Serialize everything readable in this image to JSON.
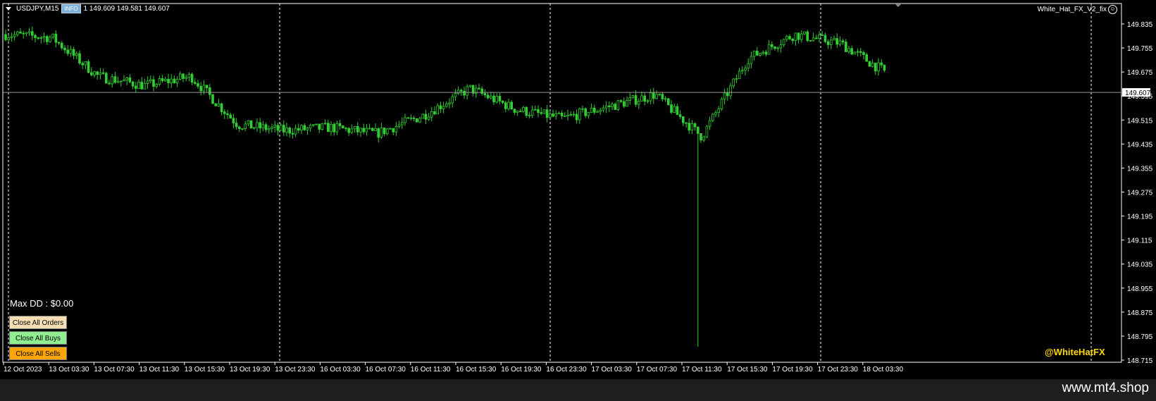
{
  "header": {
    "symbol": "USDJPY,M15",
    "info_badge": "INFO",
    "ohlc_text": "1 149.609 149.581 149.607"
  },
  "ea_name": "White_Hat_FX_V2_fix",
  "price_axis": {
    "labels": [
      "149.835",
      "149.755",
      "149.675",
      "149.595",
      "149.515",
      "149.435",
      "149.355",
      "149.275",
      "149.195",
      "149.115",
      "149.035",
      "148.955",
      "148.875",
      "148.795",
      "148.715"
    ],
    "current_price": "149.607"
  },
  "time_axis": {
    "labels": [
      "12 Oct 2023",
      "13 Oct 03:30",
      "13 Oct 07:30",
      "13 Oct 11:30",
      "13 Oct 15:30",
      "13 Oct 19:30",
      "13 Oct 23:30",
      "16 Oct 03:30",
      "16 Oct 07:30",
      "16 Oct 11:30",
      "16 Oct 15:30",
      "16 Oct 19:30",
      "16 Oct 23:30",
      "17 Oct 03:30",
      "17 Oct 07:30",
      "17 Oct 11:30",
      "17 Oct 15:30",
      "17 Oct 19:30",
      "17 Oct 23:30",
      "18 Oct 03:30"
    ]
  },
  "panel": {
    "max_dd": "Max DD : $0.00",
    "close_all_orders": "Close All Orders",
    "close_all_buys": "Close All Buys",
    "close_all_sells": "Close All Sells"
  },
  "brand": "@WhiteHatFX",
  "watermark": "www.mt4.shop",
  "colors": {
    "candle": "#32cd32",
    "background": "#000000",
    "grid": "#ffffff",
    "brand": "#ffd700"
  },
  "chart_data": {
    "type": "line",
    "title": "USDJPY,M15",
    "xlabel": "",
    "ylabel": "",
    "ylim": [
      148.715,
      149.835
    ],
    "close_path": [
      {
        "t": "12 Oct 2023",
        "p": 149.8
      },
      {
        "t": "13 Oct 03:30",
        "p": 149.79
      },
      {
        "t": "13 Oct 07:30",
        "p": 149.66
      },
      {
        "t": "13 Oct 11:30",
        "p": 149.63
      },
      {
        "t": "13 Oct 15:30",
        "p": 149.66
      },
      {
        "t": "13 Oct 19:30",
        "p": 149.5
      },
      {
        "t": "13 Oct 23:30",
        "p": 149.48
      },
      {
        "t": "16 Oct 03:30",
        "p": 149.49
      },
      {
        "t": "16 Oct 07:30",
        "p": 149.47
      },
      {
        "t": "16 Oct 11:30",
        "p": 149.53
      },
      {
        "t": "16 Oct 15:30",
        "p": 149.62
      },
      {
        "t": "16 Oct 19:30",
        "p": 149.55
      },
      {
        "t": "16 Oct 23:30",
        "p": 149.52
      },
      {
        "t": "17 Oct 03:30",
        "p": 149.56
      },
      {
        "t": "17 Oct 07:30",
        "p": 149.6
      },
      {
        "t": "17 Oct 11:30",
        "p": 149.46
      },
      {
        "t": "17 Oct 15:30",
        "p": 149.72
      },
      {
        "t": "17 Oct 19:30",
        "p": 149.8
      },
      {
        "t": "17 Oct 23:30",
        "p": 149.77
      },
      {
        "t": "18 Oct 03:30",
        "p": 149.67
      }
    ],
    "spike_low": 148.76
  }
}
